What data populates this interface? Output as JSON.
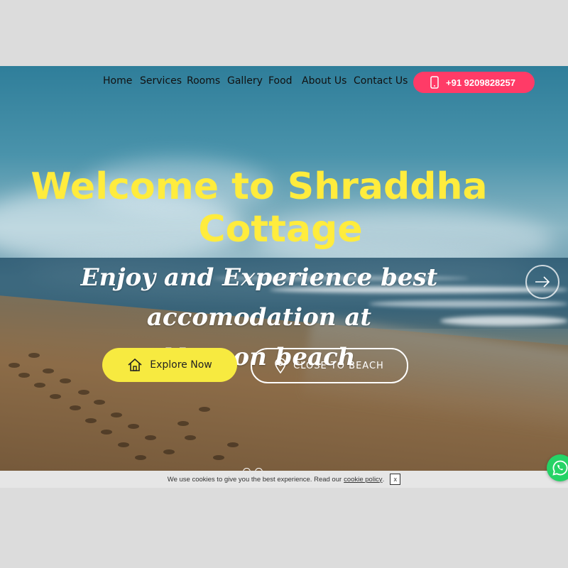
{
  "nav": {
    "items": [
      "Home",
      "Services",
      "Rooms",
      "Gallery",
      "Food",
      "About Us",
      "Contact Us"
    ],
    "phone": "+91 9209828257",
    "phone_icon": "mobile-phone-icon"
  },
  "hero": {
    "title_line1": "Welcome to Shraddha",
    "title_line2": "Cottage",
    "subtitle_line1": "Enjoy and Experience best accomodation at",
    "subtitle_line2": "Nagaon beach",
    "explore_label": "Explore Now",
    "explore_icon": "home-icon",
    "beach_label": "CLOSE TO BEACH",
    "beach_icon": "location-pin-icon",
    "next_icon": "arrow-right-icon"
  },
  "cookie": {
    "text": "We use cookies to give you the best experience. Read our",
    "link": "cookie policy",
    "after": ".",
    "close": "x"
  },
  "colors": {
    "title": "#ffec3d",
    "phone_button": "#ff3b67",
    "explore_button": "#f7ea40",
    "whatsapp": "#25d366"
  }
}
